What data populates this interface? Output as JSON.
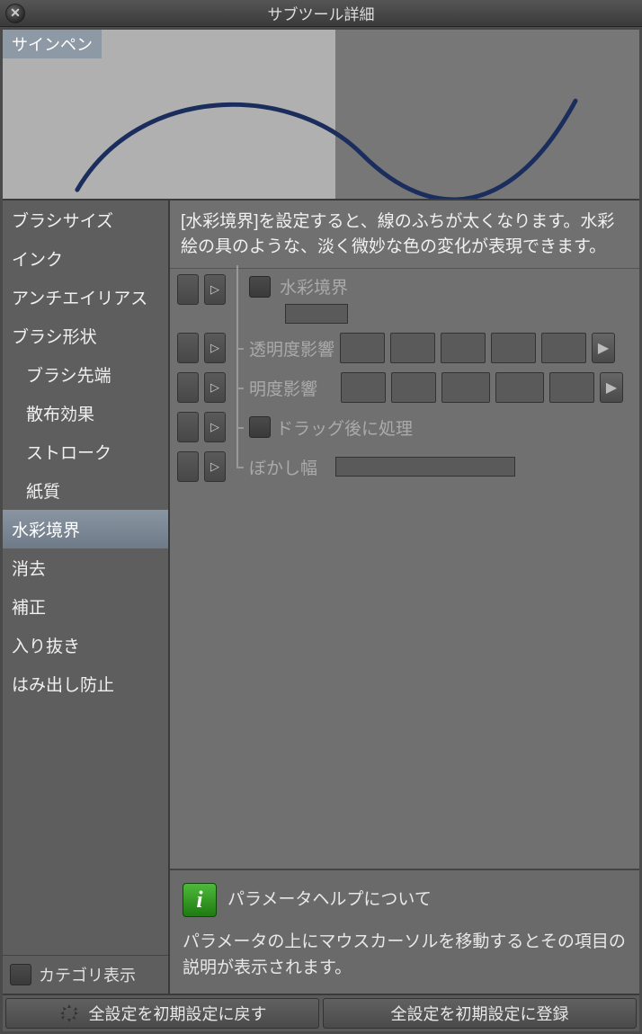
{
  "title": "サブツール詳細",
  "preview_label": "サインペン",
  "sidebar": {
    "items": [
      {
        "label": "ブラシサイズ",
        "indent": false,
        "selected": false
      },
      {
        "label": "インク",
        "indent": false,
        "selected": false
      },
      {
        "label": "アンチエイリアス",
        "indent": false,
        "selected": false
      },
      {
        "label": "ブラシ形状",
        "indent": false,
        "selected": false
      },
      {
        "label": "ブラシ先端",
        "indent": true,
        "selected": false
      },
      {
        "label": "散布効果",
        "indent": true,
        "selected": false
      },
      {
        "label": "ストローク",
        "indent": true,
        "selected": false
      },
      {
        "label": "紙質",
        "indent": true,
        "selected": false
      },
      {
        "label": "水彩境界",
        "indent": false,
        "selected": true
      },
      {
        "label": "消去",
        "indent": false,
        "selected": false
      },
      {
        "label": "補正",
        "indent": false,
        "selected": false
      },
      {
        "label": "入り抜き",
        "indent": false,
        "selected": false
      },
      {
        "label": "はみ出し防止",
        "indent": false,
        "selected": false
      }
    ],
    "category_label": "カテゴリ表示"
  },
  "description": "[水彩境界]を設定すると、線のふちが太くなります。水彩絵の具のような、淡く微妙な色の変化が表現できます。",
  "params": {
    "watercolor_border": "水彩境界",
    "opacity_effect": "透明度影響",
    "brightness_effect": "明度影響",
    "process_after_drag": "ドラッグ後に処理",
    "blur_width": "ぼかし幅"
  },
  "help": {
    "title": "パラメータヘルプについて",
    "body": "パラメータの上にマウスカーソルを移動するとその項目の説明が表示されます。"
  },
  "footer": {
    "reset": "全設定を初期設定に戻す",
    "register": "全設定を初期設定に登録"
  }
}
